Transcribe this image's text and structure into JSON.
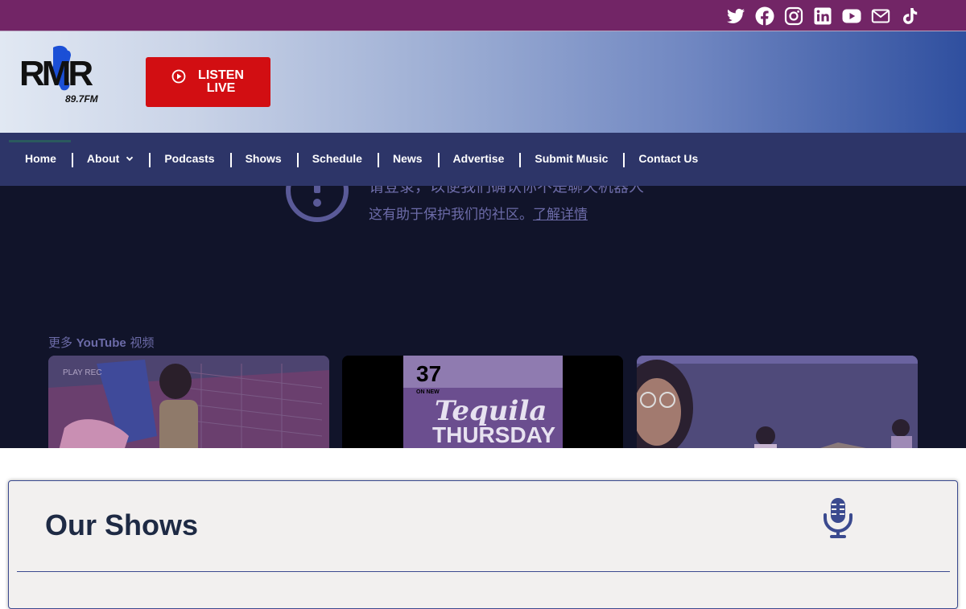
{
  "social": {
    "icons": [
      "twitter-icon",
      "facebook-icon",
      "instagram-icon",
      "linkedin-icon",
      "youtube-icon",
      "email-icon",
      "tiktok-icon"
    ]
  },
  "header": {
    "logo_text": "RMR",
    "logo_sub": "89.7FM",
    "listen_label": "LISTEN LIVE"
  },
  "nav": {
    "items": [
      "Home",
      "About",
      "Podcasts",
      "Shows",
      "Schedule",
      "News",
      "Advertise",
      "Submit Music",
      "Contact Us"
    ]
  },
  "video": {
    "message_line1": "请登录，以便我们确认你不是聊天机器人",
    "message_line2": "这有助于保护我们的社区。",
    "learn_more": "了解详情",
    "more_prefix": "更多 ",
    "more_brand": "YouTube",
    "more_suffix": " 视频",
    "thumbs": [
      {
        "overlay": "PLAY REC"
      },
      {
        "number": "37",
        "on": "ON NEW",
        "title1": "Tequila",
        "title2": "THURSDAY"
      },
      {
        "overlay": ""
      }
    ]
  },
  "shows": {
    "title": "Our Shows"
  },
  "colors": {
    "topbar": "#722566",
    "nav": "#2d3568",
    "listen_button": "#d20e12",
    "accent": "#3b4a8f"
  }
}
